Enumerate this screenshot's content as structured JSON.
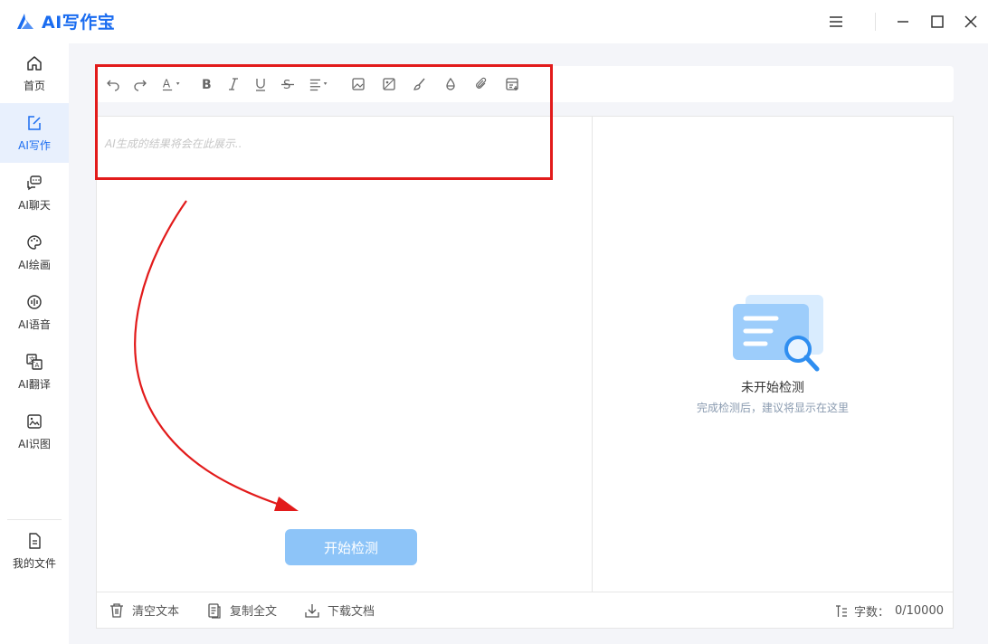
{
  "app": {
    "title": "AI写作宝",
    "brand_color": "#1a6cf0"
  },
  "window_controls": [
    {
      "name": "menu-icon"
    },
    {
      "name": "minimize-icon"
    },
    {
      "name": "maximize-icon"
    },
    {
      "name": "close-icon"
    }
  ],
  "sidebar": {
    "items": [
      {
        "label": "首页",
        "icon": "home-icon",
        "active": false
      },
      {
        "label": "AI写作",
        "icon": "edit-icon",
        "active": true
      },
      {
        "label": "AI聊天",
        "icon": "chat-icon",
        "active": false
      },
      {
        "label": "AI绘画",
        "icon": "palette-icon",
        "active": false
      },
      {
        "label": "AI语音",
        "icon": "voice-icon",
        "active": false
      },
      {
        "label": "AI翻译",
        "icon": "translate-icon",
        "active": false
      },
      {
        "label": "AI识图",
        "icon": "image-recognize-icon",
        "active": false
      }
    ],
    "bottom_item": {
      "label": "我的文件",
      "icon": "file-icon"
    }
  },
  "toolbar": {
    "buttons": [
      "undo-icon",
      "redo-icon",
      "font-color-icon",
      "bold-icon",
      "italic-icon",
      "underline-icon",
      "strikethrough-icon",
      "align-icon",
      "image-icon",
      "image-edit-icon",
      "brush-icon",
      "fill-icon",
      "attachment-icon",
      "insert-template-icon"
    ]
  },
  "editor": {
    "placeholder": "AI生成的结果将会在此展示..",
    "start_button": "开始检测"
  },
  "result_panel": {
    "empty_title": "未开始检测",
    "empty_subtitle": "完成检测后，建议将显示在这里"
  },
  "footer": {
    "clear_label": "清空文本",
    "copy_label": "复制全文",
    "download_label": "下载文档",
    "word_count_label": "字数：",
    "word_count_value": "0/10000"
  },
  "colors": {
    "annotation_red": "#e21b1b",
    "button_disabled_blue": "#8dc4f8",
    "active_bg": "#e8f0fd"
  }
}
